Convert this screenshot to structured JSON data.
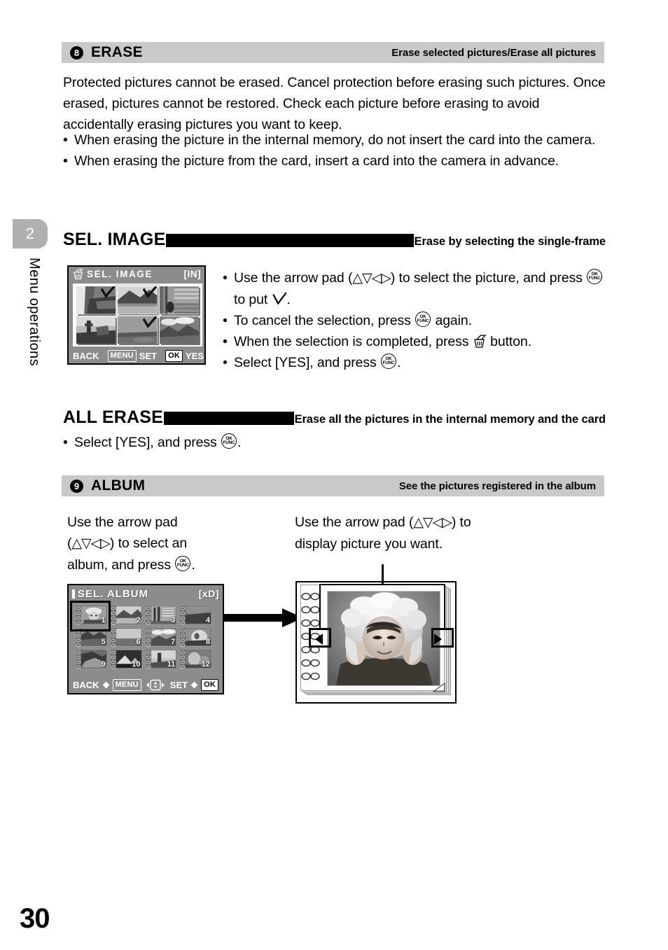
{
  "page": {
    "number": "30",
    "chapter_tab": "2",
    "chapter_label": "Menu operations"
  },
  "sections": [
    {
      "id": "erase",
      "number": "8",
      "title": "ERASE",
      "subtitle": "Erase selected pictures/Erase all pictures",
      "intro": "Protected pictures cannot be erased. Cancel protection before erasing such pictures. Once erased, pictures cannot be restored. Check each picture before erasing to avoid accidentally erasing pictures you want to keep.",
      "bullets": [
        "When erasing the picture in the internal memory, do not insert the card into the camera.",
        "When erasing the picture from the card, insert a card into the camera in advance."
      ]
    },
    {
      "id": "album",
      "number": "9",
      "title": "ALBUM",
      "subtitle": "See the pictures registered in the album"
    }
  ],
  "sel_image": {
    "heading_name": "SEL. IMAGE",
    "heading_leader": "................................................",
    "heading_desc": "Erase by selecting the single-frame",
    "screen": {
      "title": "SEL. IMAGE",
      "memory_indicator": "[IN]",
      "trash_icon": "trash-icon",
      "thumbnails": [
        {
          "index": 1,
          "checked": true,
          "selected": false
        },
        {
          "index": 2,
          "checked": true,
          "selected": true
        },
        {
          "index": 3,
          "checked": false,
          "selected": false
        },
        {
          "index": 4,
          "checked": false,
          "selected": false
        },
        {
          "index": 5,
          "checked": true,
          "selected": false
        },
        {
          "index": 6,
          "checked": false,
          "selected": false
        }
      ],
      "footer": {
        "back_label": "BACK",
        "back_key": "MENU",
        "set_label": "SET",
        "set_key": "OK",
        "yes_label": "YES",
        "yes_key": "trash-icon"
      }
    },
    "instructions": [
      {
        "pre": "Use the arrow pad (",
        "arrows": "△▽◁▷",
        "mid": ") to select the picture, and press ",
        "button": "ok-func-button",
        "post": " to put ",
        "glyph": "check-mark",
        "end": "."
      },
      {
        "pre": "To cancel the selection, press ",
        "button": "ok-func-button",
        "post": " again."
      },
      {
        "pre": "When the selection is completed, press ",
        "glyph": "trash-icon",
        "post": " button."
      },
      {
        "pre": "Select [YES], and press ",
        "button": "ok-func-button",
        "post": "."
      }
    ]
  },
  "all_erase": {
    "heading_name": "ALL ERASE",
    "heading_leader": "..................",
    "heading_desc": "Erase all the pictures in the internal memory and the card",
    "bullet": {
      "pre": "Select [YES], and press ",
      "button": "ok-func-button",
      "post": "."
    }
  },
  "album_section": {
    "left_note": {
      "line1_pre": "Use the arrow pad",
      "line2_pre": "(",
      "arrows": "△▽◁▷",
      "line2_post": ") to select an",
      "line3_pre": "album, and press ",
      "button": "ok-func-button",
      "line3_post": "."
    },
    "right_note": {
      "pre": "Use the arrow pad (",
      "arrows": "△▽◁▷",
      "post": ") to",
      "line2": "display picture you want."
    },
    "screen": {
      "title": "SEL. ALBUM",
      "memory_indicator": "[xD]",
      "albums": [
        {
          "index": 1,
          "label": "1"
        },
        {
          "index": 2,
          "label": "2"
        },
        {
          "index": 3,
          "label": "3"
        },
        {
          "index": 4,
          "label": "4"
        },
        {
          "index": 5,
          "label": "5"
        },
        {
          "index": 6,
          "label": "6"
        },
        {
          "index": 7,
          "label": "7"
        },
        {
          "index": 8,
          "label": "8"
        },
        {
          "index": 9,
          "label": "9"
        },
        {
          "index": 10,
          "label": "10"
        },
        {
          "index": 11,
          "label": "11"
        },
        {
          "index": 12,
          "label": "12"
        }
      ],
      "selected_album": 1,
      "footer": {
        "back_label": "BACK",
        "back_key": "MENU",
        "pad_key": "arrow-pad-icon",
        "set_label": "SET",
        "set_key": "OK"
      }
    },
    "photo_panel": {
      "nav_left_icon": "left-arrow-icon",
      "nav_right_icon": "right-arrow-icon",
      "photo_alt": "child-in-bonnet-photo"
    }
  },
  "colors": {
    "header_bar": "#c9c9c9",
    "tab_gray": "#b0b0b0",
    "lcd_bg": "#8c8c8c",
    "text": "#000000"
  }
}
